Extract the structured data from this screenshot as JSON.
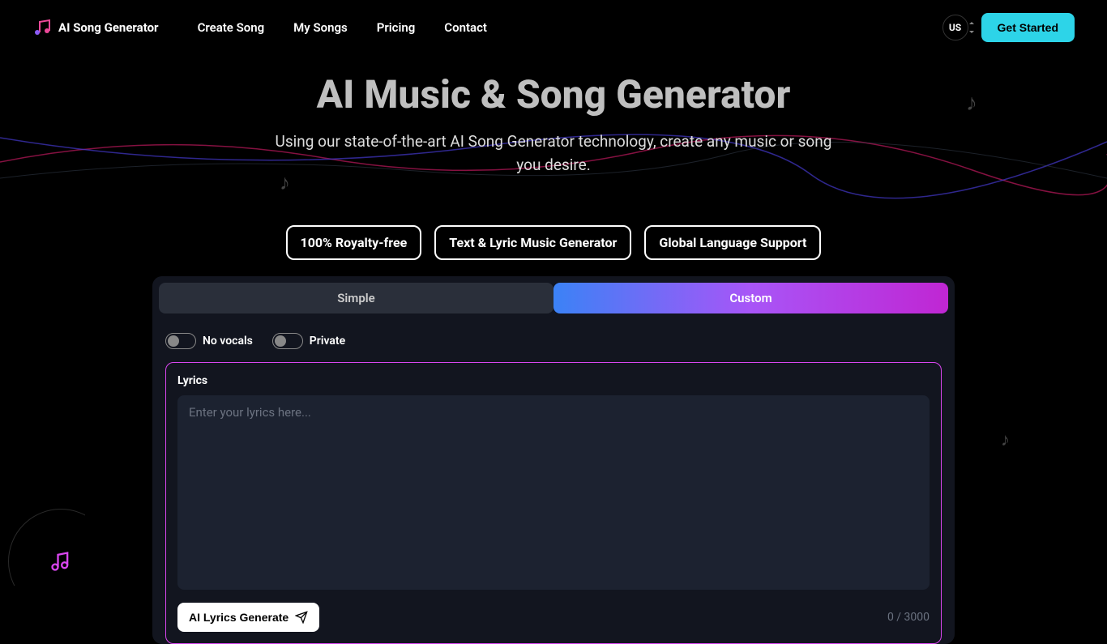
{
  "header": {
    "logo_text": "AI Song Generator",
    "nav": [
      "Create Song",
      "My Songs",
      "Pricing",
      "Contact"
    ],
    "lang": "US",
    "get_started": "Get Started"
  },
  "hero": {
    "title": "AI Music & Song Generator",
    "subtitle": "Using our state-of-the-art AI Song Generator technology, create any music or song you desire."
  },
  "badges": [
    "100% Royalty-free",
    "Text & Lyric Music Generator",
    "Global Language Support"
  ],
  "tabs": {
    "simple": "Simple",
    "custom": "Custom"
  },
  "toggles": {
    "no_vocals": "No vocals",
    "private": "Private"
  },
  "lyrics": {
    "label": "Lyrics",
    "placeholder": "Enter your lyrics here...",
    "ai_generate": "AI Lyrics Generate",
    "count": "0 / 3000"
  }
}
